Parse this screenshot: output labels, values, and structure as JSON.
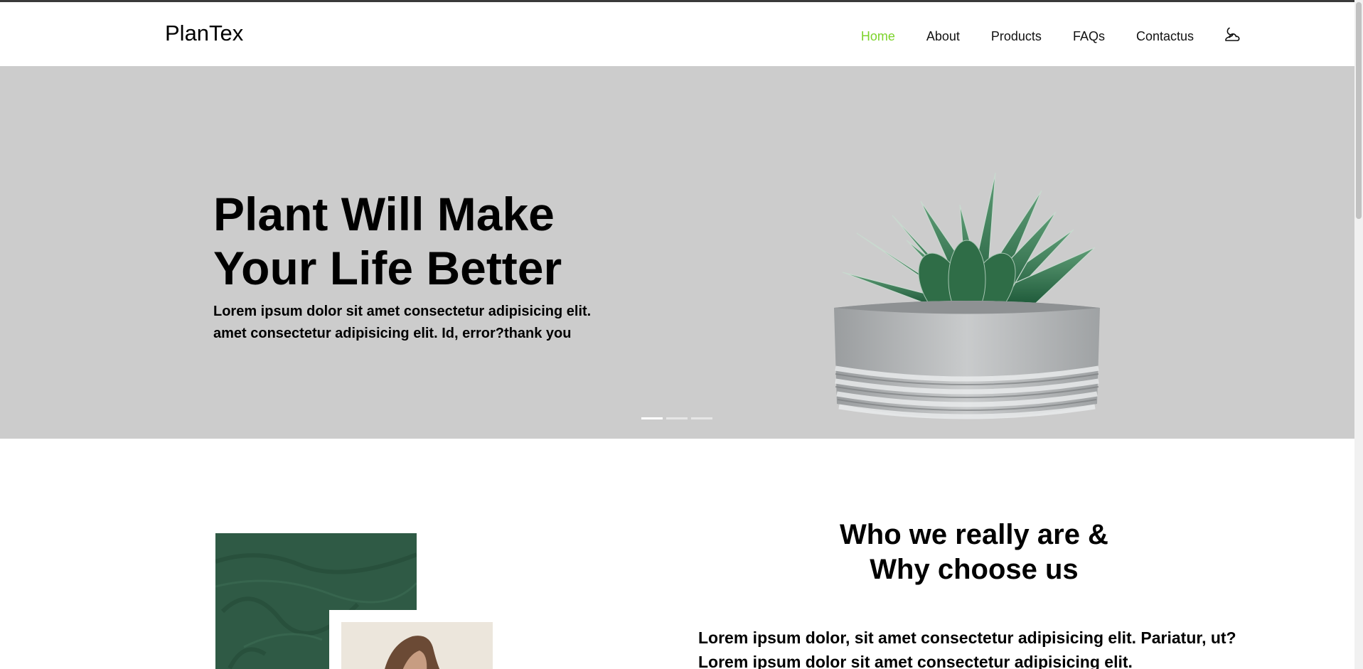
{
  "brand": {
    "name": "PlanTex"
  },
  "nav": {
    "items": [
      {
        "label": "Home",
        "active": true
      },
      {
        "label": "About",
        "active": false
      },
      {
        "label": "Products",
        "active": false
      },
      {
        "label": "FAQs",
        "active": false
      },
      {
        "label": "Contactus",
        "active": false
      }
    ],
    "theme_icon": "moon-cloud-icon"
  },
  "hero": {
    "title_line1": "Plant Will Make",
    "title_line2": "Your Life Better",
    "text_line1": "Lorem ipsum dolor sit amet consectetur adipisicing elit.",
    "text_line2": "amet consectetur adipisicing elit. Id, error?thank you",
    "slides": 3,
    "active_slide": 1,
    "image": "succulent-in-concrete-pot"
  },
  "about": {
    "title_line1": "Who we really are &",
    "title_line2": "Why choose us",
    "text_line1": "Lorem ipsum dolor, sit amet consectetur adipisicing elit. Pariatur, ut?",
    "text_line2": "Lorem ipsum dolor sit amet consectetur adipisicing elit."
  },
  "colors": {
    "accent": "#7cd32b",
    "hero_bg": "#cccccc",
    "about_green": "#2f5a45"
  }
}
